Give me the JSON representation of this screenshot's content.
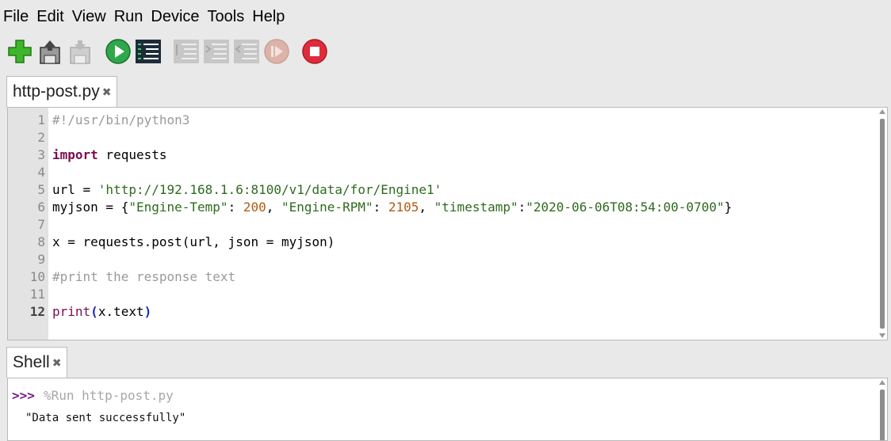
{
  "menu": [
    "File",
    "Edit",
    "View",
    "Run",
    "Device",
    "Tools",
    "Help"
  ],
  "toolbar": {
    "buttons": [
      "new-file",
      "load",
      "save",
      "run",
      "debug",
      "step-over",
      "step-into",
      "step-out",
      "resume",
      "stop"
    ]
  },
  "editor_tab": {
    "title": "http-post.py",
    "close": "✖"
  },
  "editor": {
    "line_numbers": [
      "1",
      "2",
      "3",
      "4",
      "5",
      "6",
      "7",
      "8",
      "9",
      "10",
      "11",
      "12"
    ],
    "current_line": 12,
    "lines": {
      "l1": "#!/usr/bin/python3",
      "l3_kw": "import",
      "l3_rest": " requests",
      "l5_a": "url = ",
      "l5_str": "'http://192.168.1.6:8100/v1/data/for/Engine1'",
      "l6_a": "myjson = {",
      "l6_s1": "\"Engine-Temp\"",
      "l6_b": ": ",
      "l6_n1": "200",
      "l6_c": ", ",
      "l6_s2": "\"Engine-RPM\"",
      "l6_d": ": ",
      "l6_n2": "2105",
      "l6_e": ", ",
      "l6_s3": "\"timestamp\"",
      "l6_f": ":",
      "l6_s4": "\"2020-06-06T08:54:00-0700\"",
      "l6_g": "}",
      "l8": "x = requests.post(url, json = myjson)",
      "l10": "#print the response text",
      "l12_fn": "print",
      "l12_open": "(",
      "l12_mid": "x.text",
      "l12_close": ")"
    }
  },
  "shell_tab": {
    "title": "Shell",
    "close": "✖"
  },
  "shell": {
    "prompt": ">>>",
    "command": "%Run http-post.py",
    "output": "\"Data sent successfully\""
  }
}
